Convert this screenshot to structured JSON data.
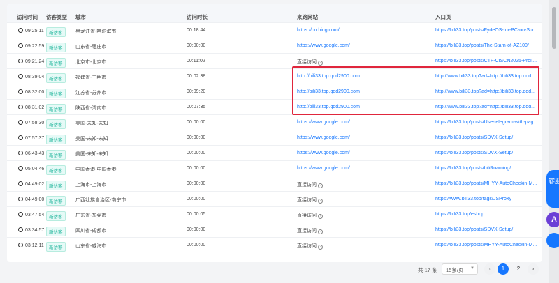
{
  "headers": {
    "time": "访问时间",
    "type": "访客类型",
    "city": "城市",
    "duration": "访问时长",
    "source": "来路网站",
    "entry": "入口页"
  },
  "rows": [
    {
      "time": "09:25:11",
      "type": "新访客",
      "city": "黑龙江省-哈尔滨市",
      "duration": "00:18:44",
      "source": "https://cn.bing.com/",
      "source_kind": "link",
      "entry": "https://bili33.top/posts/FydeOS-for-PC-on-Sur..."
    },
    {
      "time": "09:22:59",
      "type": "新访客",
      "city": "山东省-枣庄市",
      "duration": "00:00:00",
      "source": "https://www.google.com/",
      "source_kind": "link",
      "entry": "https://bili33.top/posts/The-Starn-of-AZ100/"
    },
    {
      "time": "09:21:24",
      "type": "新访客",
      "city": "北京市-北京市",
      "duration": "00:11:02",
      "source": "直接访问",
      "source_kind": "direct",
      "entry": "https://bili33.top/posts/CTF-CISCN2025-Proli..."
    },
    {
      "time": "08:39:04",
      "type": "新访客",
      "city": "福建省-三明市",
      "duration": "00:02:38",
      "source": "http://bili33.top.qdd2900.com",
      "source_kind": "link",
      "entry": "http://www.bili33.top?ad=http://bili33.top.qdd..."
    },
    {
      "time": "08:32:00",
      "type": "新访客",
      "city": "江苏省-苏州市",
      "duration": "00:09:20",
      "source": "http://bili33.top.qdd2900.com",
      "source_kind": "link",
      "entry": "http://www.bili33.top?ad=http://bili33.top.qdd..."
    },
    {
      "time": "08:31:02",
      "type": "新访客",
      "city": "陕西省-渭南市",
      "duration": "00:07:35",
      "source": "http://bili33.top.qdd2900.com",
      "source_kind": "link",
      "entry": "http://www.bili33.top?ad=http://bili33.top.qdd..."
    },
    {
      "time": "07:58:30",
      "type": "新访客",
      "city": "美国-未知-未知",
      "duration": "00:00:00",
      "source": "https://www.google.com/",
      "source_kind": "link",
      "entry": "https://bili33.top/posts/Use-telegram-with-pag..."
    },
    {
      "time": "07:57:37",
      "type": "新访客",
      "city": "美国-未知-未知",
      "duration": "00:00:00",
      "source": "https://www.google.com/",
      "source_kind": "link",
      "entry": "https://bili33.top/posts/SDVX-Setup/"
    },
    {
      "time": "06:43:43",
      "type": "新访客",
      "city": "美国-未知-未知",
      "duration": "00:00:00",
      "source": "https://www.google.com/",
      "source_kind": "link",
      "entry": "https://bili33.top/posts/SDVX-Setup/"
    },
    {
      "time": "05:04:46",
      "type": "新访客",
      "city": "中国香港-中国香港",
      "duration": "00:00:00",
      "source": "https://www.google.com/",
      "source_kind": "link",
      "entry": "https://bili33.top/posts/biliRoaming/"
    },
    {
      "time": "04:49:02",
      "type": "新访客",
      "city": "上海市-上海市",
      "duration": "00:00:00",
      "source": "直接访问",
      "source_kind": "direct",
      "entry": "https://bili33.top/posts/MHYY-AutoCheckin-M..."
    },
    {
      "time": "04:49:00",
      "type": "新访客",
      "city": "广西壮族自治区-南宁市",
      "duration": "00:00:00",
      "source": "直接访问",
      "source_kind": "direct",
      "entry": "https://www.bili33.top/tags/JSProxy"
    },
    {
      "time": "03:47:54",
      "type": "新访客",
      "city": "广东省-东莞市",
      "duration": "00:00:05",
      "source": "直接访问",
      "source_kind": "direct",
      "entry": "https://bili33.top/eshop"
    },
    {
      "time": "03:34:57",
      "type": "新访客",
      "city": "四川省-成都市",
      "duration": "00:00:00",
      "source": "直接访问",
      "source_kind": "direct",
      "entry": "https://bili33.top/posts/SDVX-Setup/"
    },
    {
      "time": "03:12:11",
      "type": "新访客",
      "city": "山东省-威海市",
      "duration": "00:00:00",
      "source": "直接访问",
      "source_kind": "direct",
      "entry": "https://bili33.top/posts/MHYY-AutoCheckin-M..."
    }
  ],
  "pagination": {
    "total": "共 17 条",
    "page_size": "15条/页",
    "prev": "‹",
    "pages": [
      "1",
      "2"
    ],
    "active_page": "1",
    "next": "›"
  },
  "floating": {
    "a_label": "客服",
    "b_label": "A"
  },
  "colors": {
    "link": "#1677ff",
    "badge_text": "#1fb59b",
    "highlight": "#e0263c",
    "active_page": "#1677ff"
  }
}
